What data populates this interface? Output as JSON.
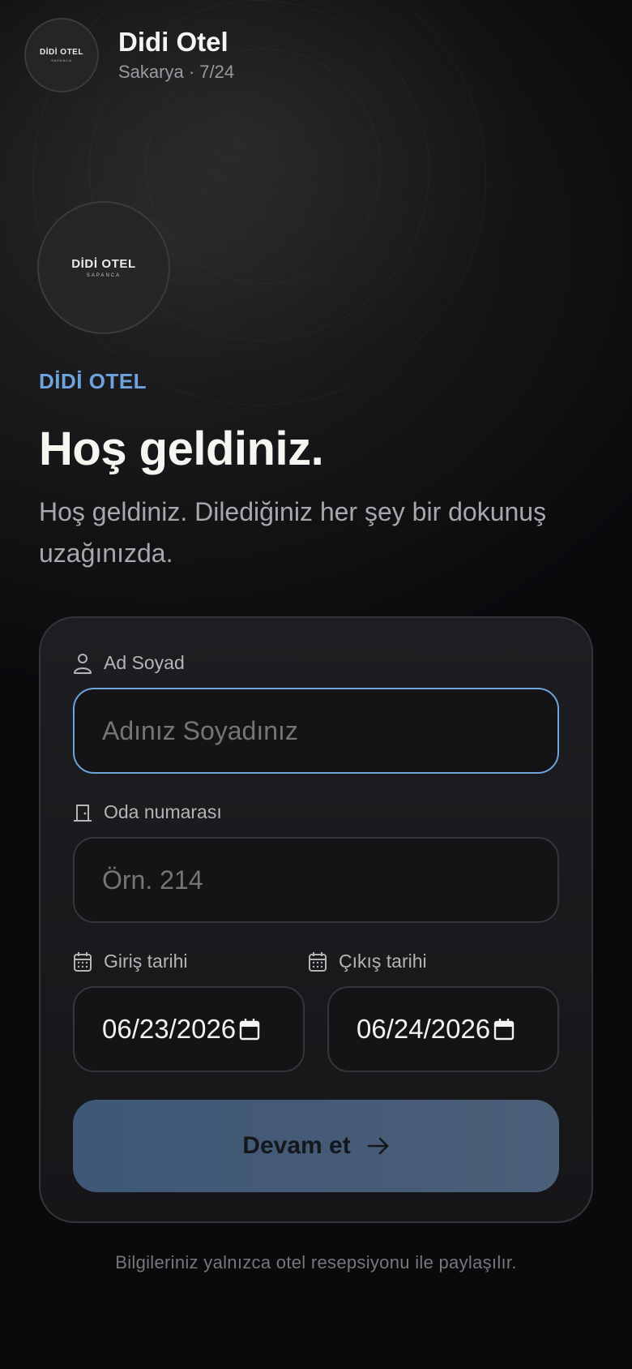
{
  "header": {
    "title": "Didi Otel",
    "subtitle": "Sakarya · 7/24",
    "logo_line1": "DİDİ OTEL",
    "logo_line2": "SAPANCA"
  },
  "hero": {
    "logo_line1": "DİDİ OTEL",
    "logo_line2": "SAPANCA",
    "brand": "DİDİ OTEL",
    "heading": "Hoş geldiniz.",
    "intro": "Hoş geldiniz. Dilediğiniz her şey bir dokunuş uzağınızda."
  },
  "form": {
    "name": {
      "label": "Ad Soyad",
      "placeholder": "Adınız Soyadınız",
      "value": ""
    },
    "room": {
      "label": "Oda numarası",
      "placeholder": "Örn. 214",
      "value": ""
    },
    "checkin": {
      "label": "Giriş tarihi",
      "value": "06/23/2026"
    },
    "checkout": {
      "label": "Çıkış tarihi",
      "value": "06/24/2026"
    },
    "submit_label": "Devam et"
  },
  "footnote": "Bilgileriniz yalnızca otel resepsiyonu ile paylaşılır.",
  "icons": {
    "name": "person-icon",
    "room": "door-icon",
    "date": "calendar-icon",
    "submit": "arrow-right-icon"
  },
  "colors": {
    "accent": "#6ea3dd",
    "button": "#465b76",
    "background": "#0c0c0f"
  }
}
